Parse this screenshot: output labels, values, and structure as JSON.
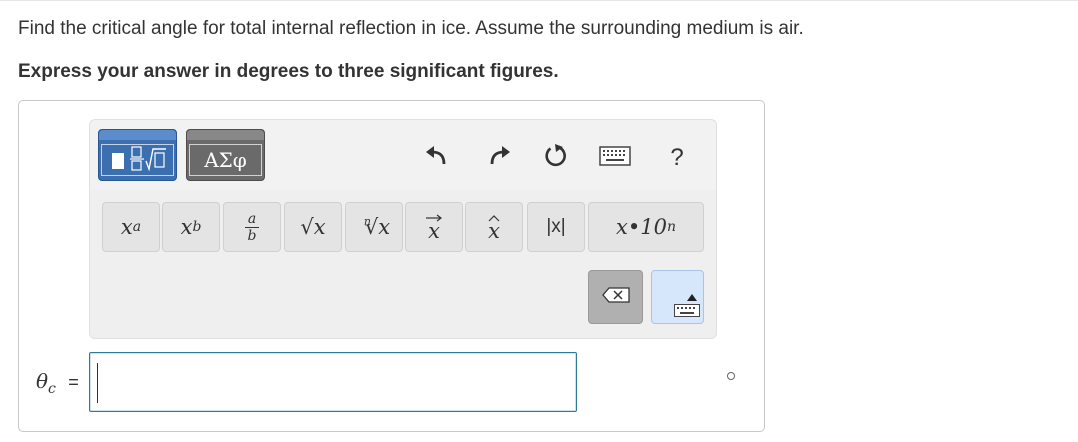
{
  "question": {
    "text": "Find the critical angle for total internal reflection in ice. Assume the surrounding medium is air.",
    "instruction": "Express your answer in degrees to three significant figures."
  },
  "toolbar": {
    "tabs": [
      {
        "name": "templates",
        "label": "",
        "icon": "templates-icon",
        "selected": true
      },
      {
        "name": "symbols",
        "label": "ΑΣφ",
        "selected": false
      }
    ],
    "actions": [
      {
        "name": "undo",
        "icon": "undo-icon"
      },
      {
        "name": "redo",
        "icon": "redo-icon"
      },
      {
        "name": "reset",
        "icon": "reset-icon"
      },
      {
        "name": "keyboard",
        "icon": "keyboard-icon"
      },
      {
        "name": "help",
        "label": "?"
      }
    ],
    "keys": [
      {
        "name": "superscript",
        "label": "x",
        "mod": "a"
      },
      {
        "name": "subscript",
        "label": "x",
        "mod": "b"
      },
      {
        "name": "fraction",
        "num": "a",
        "den": "b"
      },
      {
        "name": "sqrt",
        "label": "√x"
      },
      {
        "name": "nth-root",
        "index": "n",
        "label": "√x"
      },
      {
        "name": "vector",
        "label": "x"
      },
      {
        "name": "unit-vector",
        "label": "x"
      },
      {
        "name": "absolute",
        "label": "|x|"
      },
      {
        "name": "sci-notation",
        "label": "x•10",
        "mod": "n"
      }
    ],
    "colors": {
      "templates_tab": "#3b6fb0",
      "symbols_tab": "#6a6a6a",
      "keyboard_toggle": "#d6e6fb"
    }
  },
  "answer": {
    "label": "θ",
    "label_sub": "c",
    "equals": "=",
    "value": ""
  }
}
